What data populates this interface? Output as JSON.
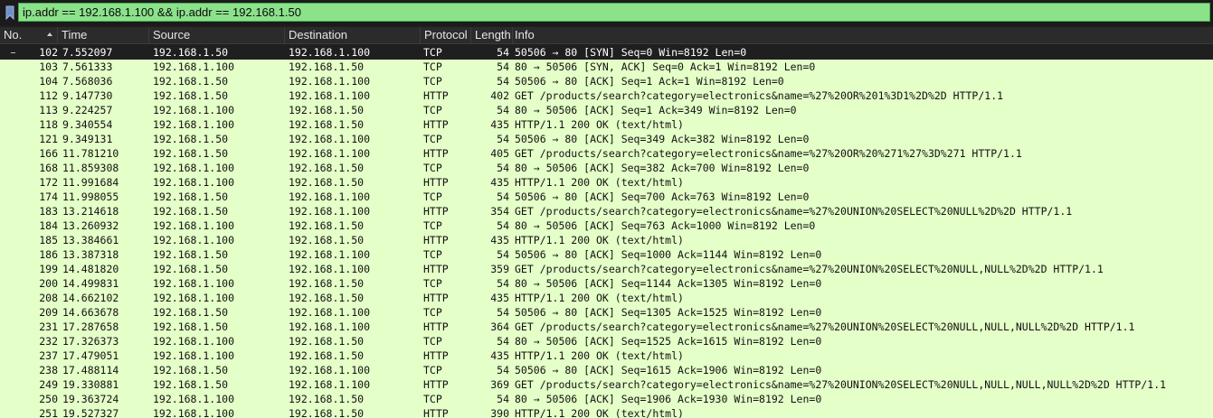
{
  "filter": {
    "value": "ip.addr == 192.168.1.100 && ip.addr == 192.168.1.50",
    "bookmark_icon": "bookmark-icon"
  },
  "columns": {
    "no": "No.",
    "time": "Time",
    "source": "Source",
    "destination": "Destination",
    "protocol": "Protocol",
    "length": "Length",
    "info": "Info"
  },
  "colors": {
    "row_bg": "#e4ffc7",
    "selected_bg": "#1f1f1f",
    "filter_bg": "#8be28b"
  },
  "packets": [
    {
      "no": "102",
      "time": "7.552097",
      "src": "192.168.1.50",
      "dst": "192.168.1.100",
      "proto": "TCP",
      "len": "54",
      "info": "50506 → 80 [SYN] Seq=0 Win=8192 Len=0"
    },
    {
      "no": "103",
      "time": "7.561333",
      "src": "192.168.1.100",
      "dst": "192.168.1.50",
      "proto": "TCP",
      "len": "54",
      "info": "80 → 50506 [SYN, ACK] Seq=0 Ack=1 Win=8192 Len=0"
    },
    {
      "no": "104",
      "time": "7.568036",
      "src": "192.168.1.50",
      "dst": "192.168.1.100",
      "proto": "TCP",
      "len": "54",
      "info": "50506 → 80 [ACK] Seq=1 Ack=1 Win=8192 Len=0"
    },
    {
      "no": "112",
      "time": "9.147730",
      "src": "192.168.1.50",
      "dst": "192.168.1.100",
      "proto": "HTTP",
      "len": "402",
      "info": "GET /products/search?category=electronics&name=%27%20OR%201%3D1%2D%2D HTTP/1.1"
    },
    {
      "no": "113",
      "time": "9.224257",
      "src": "192.168.1.100",
      "dst": "192.168.1.50",
      "proto": "TCP",
      "len": "54",
      "info": "80 → 50506 [ACK] Seq=1 Ack=349 Win=8192 Len=0"
    },
    {
      "no": "118",
      "time": "9.340554",
      "src": "192.168.1.100",
      "dst": "192.168.1.50",
      "proto": "HTTP",
      "len": "435",
      "info": "HTTP/1.1 200 OK  (text/html)"
    },
    {
      "no": "121",
      "time": "9.349131",
      "src": "192.168.1.50",
      "dst": "192.168.1.100",
      "proto": "TCP",
      "len": "54",
      "info": "50506 → 80 [ACK] Seq=349 Ack=382 Win=8192 Len=0"
    },
    {
      "no": "166",
      "time": "11.781210",
      "src": "192.168.1.50",
      "dst": "192.168.1.100",
      "proto": "HTTP",
      "len": "405",
      "info": "GET /products/search?category=electronics&name=%27%20OR%20%271%27%3D%271 HTTP/1.1"
    },
    {
      "no": "168",
      "time": "11.859308",
      "src": "192.168.1.100",
      "dst": "192.168.1.50",
      "proto": "TCP",
      "len": "54",
      "info": "80 → 50506 [ACK] Seq=382 Ack=700 Win=8192 Len=0"
    },
    {
      "no": "172",
      "time": "11.991684",
      "src": "192.168.1.100",
      "dst": "192.168.1.50",
      "proto": "HTTP",
      "len": "435",
      "info": "HTTP/1.1 200 OK  (text/html)"
    },
    {
      "no": "174",
      "time": "11.998055",
      "src": "192.168.1.50",
      "dst": "192.168.1.100",
      "proto": "TCP",
      "len": "54",
      "info": "50506 → 80 [ACK] Seq=700 Ack=763 Win=8192 Len=0"
    },
    {
      "no": "183",
      "time": "13.214618",
      "src": "192.168.1.50",
      "dst": "192.168.1.100",
      "proto": "HTTP",
      "len": "354",
      "info": "GET /products/search?category=electronics&name=%27%20UNION%20SELECT%20NULL%2D%2D HTTP/1.1"
    },
    {
      "no": "184",
      "time": "13.260932",
      "src": "192.168.1.100",
      "dst": "192.168.1.50",
      "proto": "TCP",
      "len": "54",
      "info": "80 → 50506 [ACK] Seq=763 Ack=1000 Win=8192 Len=0"
    },
    {
      "no": "185",
      "time": "13.384661",
      "src": "192.168.1.100",
      "dst": "192.168.1.50",
      "proto": "HTTP",
      "len": "435",
      "info": "HTTP/1.1 200 OK  (text/html)"
    },
    {
      "no": "186",
      "time": "13.387318",
      "src": "192.168.1.50",
      "dst": "192.168.1.100",
      "proto": "TCP",
      "len": "54",
      "info": "50506 → 80 [ACK] Seq=1000 Ack=1144 Win=8192 Len=0"
    },
    {
      "no": "199",
      "time": "14.481820",
      "src": "192.168.1.50",
      "dst": "192.168.1.100",
      "proto": "HTTP",
      "len": "359",
      "info": "GET /products/search?category=electronics&name=%27%20UNION%20SELECT%20NULL,NULL%2D%2D HTTP/1.1"
    },
    {
      "no": "200",
      "time": "14.499831",
      "src": "192.168.1.100",
      "dst": "192.168.1.50",
      "proto": "TCP",
      "len": "54",
      "info": "80 → 50506 [ACK] Seq=1144 Ack=1305 Win=8192 Len=0"
    },
    {
      "no": "208",
      "time": "14.662102",
      "src": "192.168.1.100",
      "dst": "192.168.1.50",
      "proto": "HTTP",
      "len": "435",
      "info": "HTTP/1.1 200 OK  (text/html)"
    },
    {
      "no": "209",
      "time": "14.663678",
      "src": "192.168.1.50",
      "dst": "192.168.1.100",
      "proto": "TCP",
      "len": "54",
      "info": "50506 → 80 [ACK] Seq=1305 Ack=1525 Win=8192 Len=0"
    },
    {
      "no": "231",
      "time": "17.287658",
      "src": "192.168.1.50",
      "dst": "192.168.1.100",
      "proto": "HTTP",
      "len": "364",
      "info": "GET /products/search?category=electronics&name=%27%20UNION%20SELECT%20NULL,NULL,NULL%2D%2D HTTP/1.1"
    },
    {
      "no": "232",
      "time": "17.326373",
      "src": "192.168.1.100",
      "dst": "192.168.1.50",
      "proto": "TCP",
      "len": "54",
      "info": "80 → 50506 [ACK] Seq=1525 Ack=1615 Win=8192 Len=0"
    },
    {
      "no": "237",
      "time": "17.479051",
      "src": "192.168.1.100",
      "dst": "192.168.1.50",
      "proto": "HTTP",
      "len": "435",
      "info": "HTTP/1.1 200 OK  (text/html)"
    },
    {
      "no": "238",
      "time": "17.488114",
      "src": "192.168.1.50",
      "dst": "192.168.1.100",
      "proto": "TCP",
      "len": "54",
      "info": "50506 → 80 [ACK] Seq=1615 Ack=1906 Win=8192 Len=0"
    },
    {
      "no": "249",
      "time": "19.330881",
      "src": "192.168.1.50",
      "dst": "192.168.1.100",
      "proto": "HTTP",
      "len": "369",
      "info": "GET /products/search?category=electronics&name=%27%20UNION%20SELECT%20NULL,NULL,NULL,NULL%2D%2D HTTP/1.1"
    },
    {
      "no": "250",
      "time": "19.363724",
      "src": "192.168.1.100",
      "dst": "192.168.1.50",
      "proto": "TCP",
      "len": "54",
      "info": "80 → 50506 [ACK] Seq=1906 Ack=1930 Win=8192 Len=0"
    },
    {
      "no": "251",
      "time": "19.527327",
      "src": "192.168.1.100",
      "dst": "192.168.1.50",
      "proto": "HTTP",
      "len": "390",
      "info": "HTTP/1.1 200 OK  (text/html)"
    }
  ]
}
